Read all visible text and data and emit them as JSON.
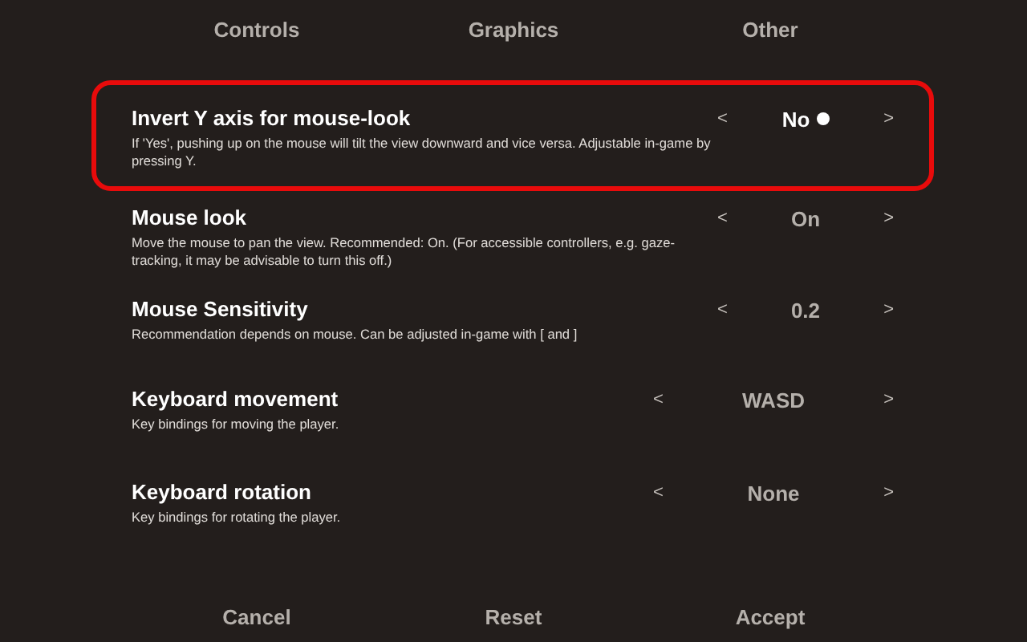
{
  "tabs": [
    {
      "label": "Controls"
    },
    {
      "label": "Graphics"
    },
    {
      "label": "Other"
    }
  ],
  "settings": [
    {
      "kind": "short",
      "title": "Invert Y axis for mouse-look",
      "description": "If 'Yes', pushing up on the mouse will tilt the view downward and vice versa. Adjustable in-game by pressing Y.",
      "prev": "<",
      "value": "No",
      "next": ">",
      "selected": true
    },
    {
      "kind": "short",
      "title": "Mouse look",
      "description": "Move the mouse to pan the view. Recommended: On. (For accessible controllers, e.g. gaze-tracking, it may be advisable to turn this off.)",
      "prev": "<",
      "value": "On",
      "next": ">",
      "selected": false
    },
    {
      "kind": "short",
      "title": "Mouse Sensitivity",
      "description": "Recommendation depends on mouse. Can be adjusted in-game with [ and ]",
      "prev": "<",
      "value": "0.2",
      "next": ">",
      "selected": false
    },
    {
      "kind": "wide",
      "title": "Keyboard movement",
      "description": "Key bindings for moving the player.",
      "prev": "<",
      "value": "WASD",
      "next": ">",
      "selected": false
    },
    {
      "kind": "wide",
      "title": "Keyboard rotation",
      "description": "Key bindings for rotating the player.",
      "prev": "<",
      "value": "None",
      "next": ">",
      "selected": false
    }
  ],
  "buttons": [
    "Cancel",
    "Reset",
    "Accept"
  ]
}
